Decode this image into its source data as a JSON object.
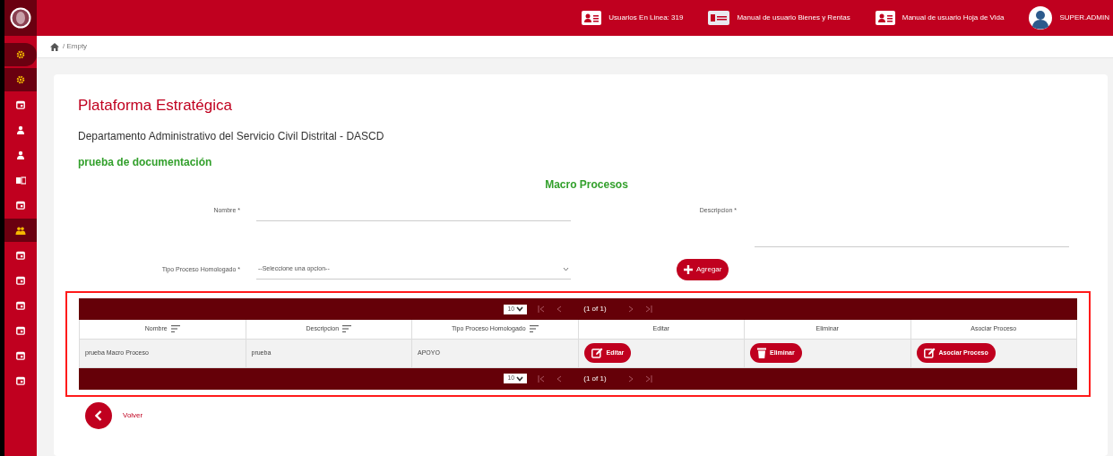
{
  "sidebar": {
    "items": [
      {
        "kind": "gear",
        "selected": true
      },
      {
        "kind": "gear",
        "selected": true
      },
      {
        "kind": "calendar",
        "selected": false
      },
      {
        "kind": "user",
        "selected": false
      },
      {
        "kind": "user",
        "selected": false
      },
      {
        "kind": "card",
        "selected": false
      },
      {
        "kind": "calendar",
        "selected": false
      },
      {
        "kind": "people",
        "selected": true
      },
      {
        "kind": "calendar",
        "selected": false
      },
      {
        "kind": "calendar",
        "selected": false
      },
      {
        "kind": "calendar",
        "selected": false
      },
      {
        "kind": "calendar",
        "selected": false
      },
      {
        "kind": "calendar",
        "selected": false
      },
      {
        "kind": "calendar",
        "selected": false
      }
    ]
  },
  "topbar": {
    "links": [
      {
        "kind": "card",
        "label": "Usuarios En Linea: 319"
      },
      {
        "kind": "money",
        "label": "Manual de usuario Bienes y Rentas"
      },
      {
        "kind": "card",
        "label": "Manual de usuario Hoja de Vida"
      }
    ],
    "user": "SUPER.ADMIN"
  },
  "breadcrumb": "/ Empty",
  "title": "Plataforma Estratégica",
  "entity": "Departamento Administrativo del Servicio Civil Distrital - DASCD",
  "subtitle": "prueba de documentación",
  "section": "Macro Procesos",
  "form": {
    "nombre_label": "Nombre *",
    "descripcion_label": "Descripcion *",
    "tipo_label": "Tipo Proceso Homologado *",
    "tipo_placeholder": "--Seleccione una opcion--",
    "add_button": "Agregar"
  },
  "table": {
    "paginators": [
      {
        "page_size": "10",
        "page_info": "(1 of 1)"
      },
      {
        "page_size": "10",
        "page_info": "(1 of 1)"
      }
    ],
    "columns": [
      {
        "label": "Nombre",
        "sortable": true
      },
      {
        "label": "Descripcion",
        "sortable": true
      },
      {
        "label": "Tipo Proceso Homologado",
        "sortable": true
      },
      {
        "label": "Editar",
        "sortable": false
      },
      {
        "label": "Eliminar",
        "sortable": false
      },
      {
        "label": "Asociar Proceso",
        "sortable": false
      }
    ],
    "rows": [
      {
        "nombre": "prueba Macro Proceso",
        "descripcion": "prueba",
        "tipo": "APOYO",
        "edit": "Editar",
        "delete": "Eliminar",
        "associate": "Asociar Proceso"
      }
    ]
  },
  "back_label": "Volver"
}
